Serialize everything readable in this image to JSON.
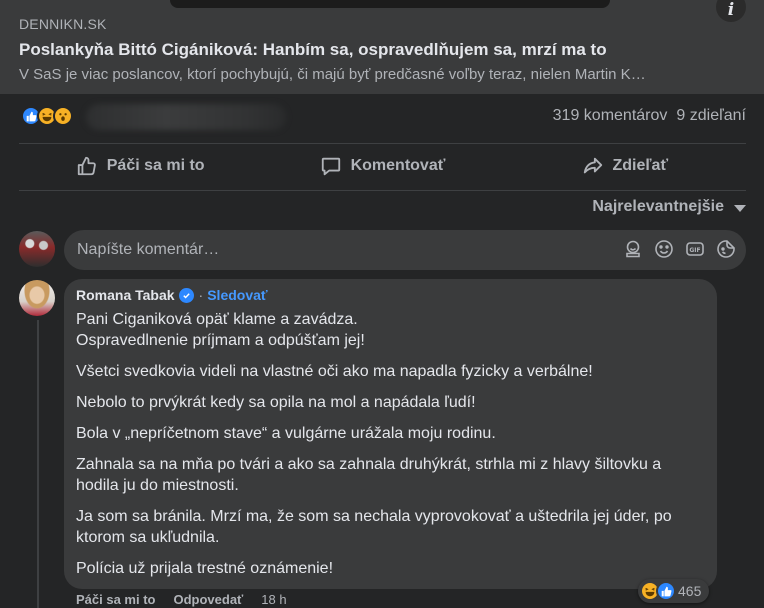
{
  "link_preview": {
    "domain": "DENNIKN.SK",
    "headline": "Poslankyňa Bittó Cigániková: Hanbím sa, ospravedlňujem sa, mrzí ma to",
    "description": "V SaS je viac poslancov, ktorí pochybujú, či majú byť predčasné voľby teraz, nielen Martin K…",
    "info_icon": "info-icon"
  },
  "post_stats": {
    "reaction_icons": [
      "like-reaction-icon",
      "haha-reaction-icon",
      "wow-reaction-icon"
    ],
    "comments_count": "319 komentárov",
    "shares_count": "9 zdieľaní"
  },
  "post_actions": {
    "like_label": "Páči sa mi to",
    "comment_label": "Komentovať",
    "share_label": "Zdieľať"
  },
  "sort": {
    "label": "Najrelevantnejšie"
  },
  "composer": {
    "placeholder": "Napíšte komentár…",
    "tools": [
      "avatar-sticker-icon",
      "emoji-icon",
      "gif-icon",
      "sticker-icon"
    ]
  },
  "comment": {
    "author": "Romana Tabak",
    "follow_label": "Sledovať",
    "paragraphs": [
      "Pani Ciganiková opäť klame a zavádza.\nOspravedlnenie príjmam a odpúšťam jej!",
      "Všetci svedkovia videli na vlastné oči ako ma napadla fyzicky a verbálne!",
      "Nebolo to prvýkrát kedy sa opila na mol a napádala ľudí!",
      "Bola v „nepríčetnom stave“ a vulgárne urážala moju rodinu.",
      "Zahnala sa na mňa po tvári a ako sa zahnala druhýkrát, strhla mi z hlavy šiltovku a hodila ju do miestnosti.",
      "Ja som sa bránila. Mrzí ma, že som sa nechala vyprovokovať a uštedrila jej úder, po ktorom sa ukľudnila.",
      "Polícia už prijala trestné oznámenie!"
    ],
    "reaction_count": "465",
    "like_label": "Páči sa mi to",
    "reply_label": "Odpovedať",
    "time": "18 h"
  },
  "colors": {
    "background": "#242526",
    "surface": "#3a3b3c",
    "text_primary": "#e4e6eb",
    "text_secondary": "#b0b3b8",
    "link_blue": "#4599ff",
    "like_blue": "#2d88ff",
    "emoji_yellow": "#f7b125"
  }
}
